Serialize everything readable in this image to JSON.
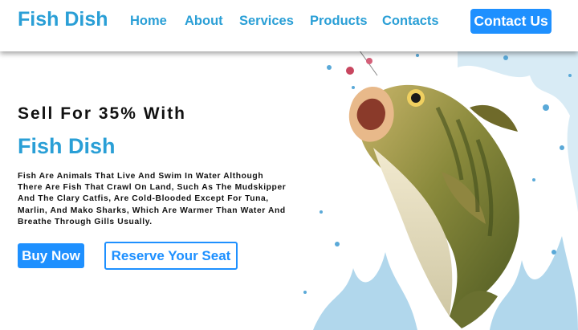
{
  "brand": {
    "logo_text": "Fish Dish",
    "accent_color": "#2a9fd6",
    "button_color": "#1e90ff"
  },
  "nav": {
    "links": [
      "Home",
      "About",
      "Services",
      "Products",
      "Contacts"
    ],
    "cta_label": "Contact Us"
  },
  "hero": {
    "headline": "Sell For 35% With",
    "brand_name": "Fish Dish",
    "description": "Fish Are Animals That Live And Swim In Water Although There Are Fish That Crawl On Land, Such As The Mudskipper And The Clary Catfis, Are Cold-Blooded Except For Tuna, Marlin, And Mako Sharks, Which Are Warmer Than Water And Breathe Through Gills Usually.",
    "primary_button": "Buy Now",
    "secondary_button": "Reserve Your Seat",
    "image": "leaping-bass-fish-with-water-splash"
  }
}
